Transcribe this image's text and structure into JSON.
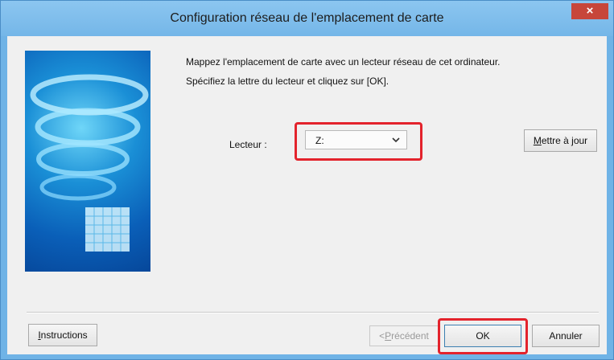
{
  "window": {
    "title": "Configuration réseau de l'emplacement de carte",
    "close_glyph": "×"
  },
  "content": {
    "description_line1": "Mappez l'emplacement de carte avec un lecteur réseau de cet ordinateur.",
    "description_line2": "Spécifiez la lettre du lecteur et cliquez sur [OK].",
    "drive_label": "Lecteur :",
    "drive_value": "Z:",
    "drive_dropdown_icon": "chevron-down-icon",
    "update_button": {
      "mnemonic": "M",
      "rest": "ettre à jour"
    }
  },
  "footer": {
    "instructions_button": {
      "mnemonic": "I",
      "rest": "nstructions"
    },
    "previous_button": {
      "prefix": "<",
      "mnemonic": "P",
      "rest": "récédent"
    },
    "ok_button": "OK",
    "cancel_button": "Annuler"
  },
  "colors": {
    "highlight": "#e3232c",
    "titlebar": "#74b6e8",
    "close_button": "#c7463a"
  }
}
